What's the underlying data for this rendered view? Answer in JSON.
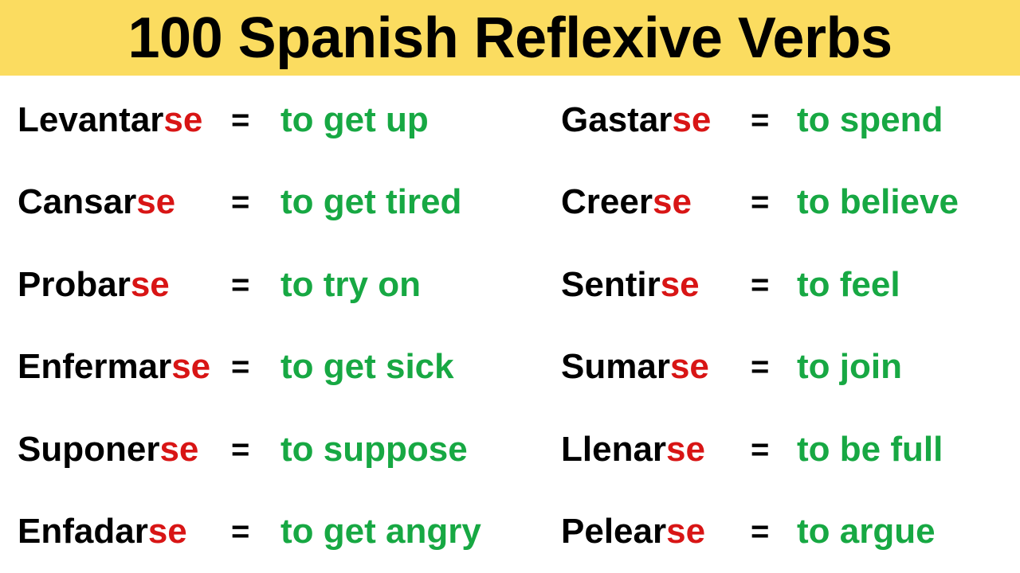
{
  "header": {
    "title": "100 Spanish Reflexive Verbs",
    "background_color": "#FBDC60",
    "text_color": "#000000"
  },
  "colors": {
    "banner_yellow": "#FBDC60",
    "spanish_stem_black": "#000000",
    "reflexive_suffix_red": "#D81515",
    "english_green": "#17A843",
    "page_background": "#FFFFFF"
  },
  "equals_sign": "=",
  "columns": {
    "left": {
      "rows": [
        {
          "stem": "Levantar",
          "suffix": "se",
          "equals": "=",
          "english": "to get up"
        },
        {
          "stem": "Cansar",
          "suffix": "se",
          "equals": "=",
          "english": "to get tired"
        },
        {
          "stem": "Probar",
          "suffix": "se",
          "equals": "=",
          "english": "to try on"
        },
        {
          "stem": "Enfermar",
          "suffix": "se",
          "equals": "=",
          "english": "to get sick"
        },
        {
          "stem": "Suponer",
          "suffix": "se",
          "equals": "=",
          "english": "to suppose"
        },
        {
          "stem": "Enfadar",
          "suffix": "se",
          "equals": "=",
          "english": "to get angry"
        }
      ]
    },
    "right": {
      "rows": [
        {
          "stem": "Gastar",
          "suffix": "se",
          "equals": "=",
          "english": "to spend"
        },
        {
          "stem": "Creer",
          "suffix": "se",
          "equals": "=",
          "english": "to believe"
        },
        {
          "stem": "Sentir",
          "suffix": "se",
          "equals": "=",
          "english": "to feel"
        },
        {
          "stem": "Sumar",
          "suffix": "se",
          "equals": "=",
          "english": "to join"
        },
        {
          "stem": "Llenar",
          "suffix": "se",
          "equals": "=",
          "english": "to be full"
        },
        {
          "stem": "Pelear",
          "suffix": "se",
          "equals": "=",
          "english": "to argue"
        }
      ]
    }
  }
}
